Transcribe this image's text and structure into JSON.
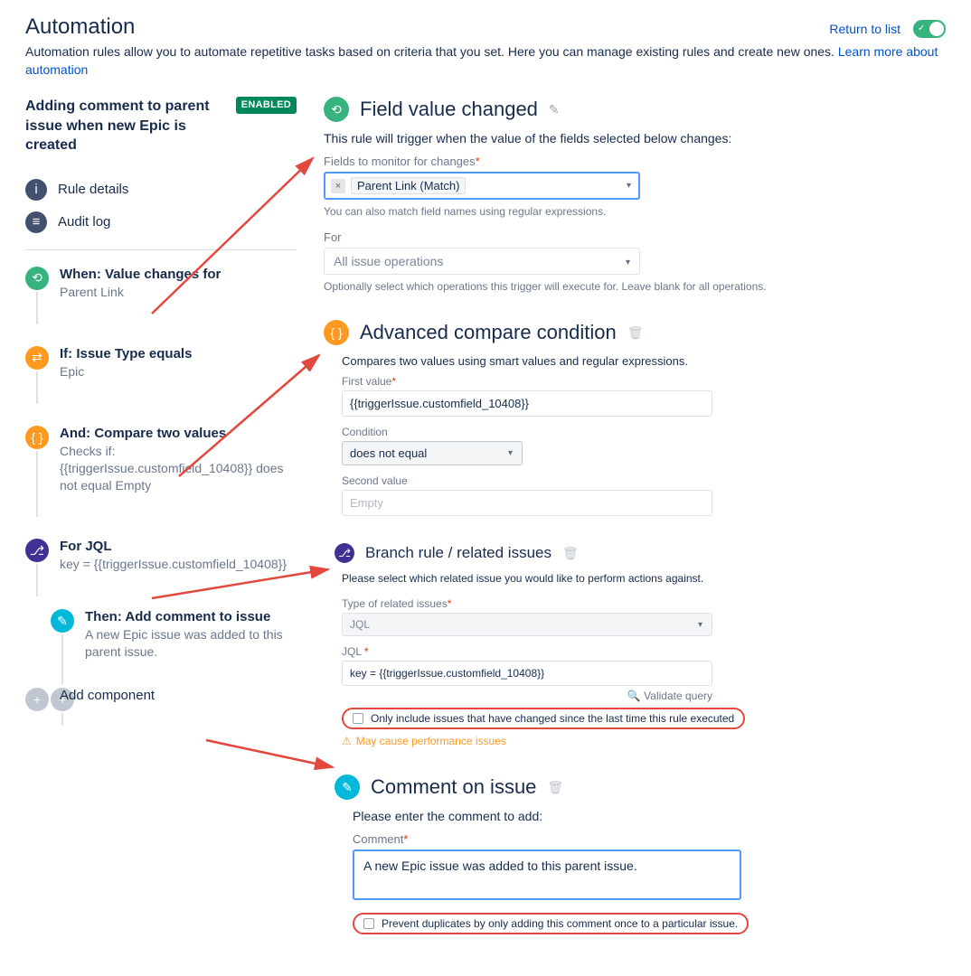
{
  "header": {
    "title": "Automation",
    "return_link": "Return to list",
    "description_pre": "Automation rules allow you to automate repetitive tasks based on criteria that you set. Here you can manage existing rules and create new ones. ",
    "learn_more": "Learn more about automation"
  },
  "rule": {
    "name": "Adding comment to parent issue when new Epic is created",
    "status_badge": "ENABLED",
    "nav": {
      "details": "Rule details",
      "audit": "Audit log"
    },
    "steps": {
      "when": {
        "title": "When: Value changes for",
        "sub": "Parent Link"
      },
      "if": {
        "title": "If: Issue Type equals",
        "sub": "Epic"
      },
      "and": {
        "title": "And: Compare two values",
        "sub1": "Checks if:",
        "sub2": "{{triggerIssue.customfield_10408}} does not equal Empty"
      },
      "for": {
        "title": "For JQL",
        "sub": "key = {{triggerIssue.customfield_10408}}"
      },
      "then": {
        "title": "Then: Add comment to issue",
        "sub": "A new Epic issue was added to this parent issue."
      },
      "add": {
        "title": "Add component"
      }
    }
  },
  "right": {
    "trigger": {
      "title": "Field value changed",
      "helper": "This rule will trigger when the value of the fields selected below changes:",
      "fields_label": "Fields to monitor for changes",
      "tag": "Parent Link (Match)",
      "hint": "You can also match field names using regular expressions.",
      "for_label": "For",
      "for_value": "All issue operations",
      "for_hint": "Optionally select which operations this trigger will execute for. Leave blank for all operations."
    },
    "condition": {
      "title": "Advanced compare condition",
      "helper": "Compares two values using smart values and regular expressions.",
      "first_label": "First value",
      "first_value": "{{triggerIssue.customfield_10408}}",
      "cond_label": "Condition",
      "cond_value": "does not equal",
      "second_label": "Second value",
      "second_value": "Empty"
    },
    "branch": {
      "title": "Branch rule / related issues",
      "helper": "Please select which related issue you would like to perform actions against.",
      "type_label": "Type of related issues",
      "type_value": "JQL",
      "jql_label": "JQL",
      "jql_value": "key = {{triggerIssue.customfield_10408}}",
      "validate": "Validate query",
      "only_include": "Only include issues that have changed since the last time this rule executed",
      "warn": "May cause performance issues"
    },
    "comment": {
      "title": "Comment on issue",
      "helper": "Please enter the comment to add:",
      "label": "Comment",
      "value": "A new Epic issue was added to this parent issue.",
      "prevent": "Prevent duplicates by only adding this comment once to a particular issue."
    }
  }
}
